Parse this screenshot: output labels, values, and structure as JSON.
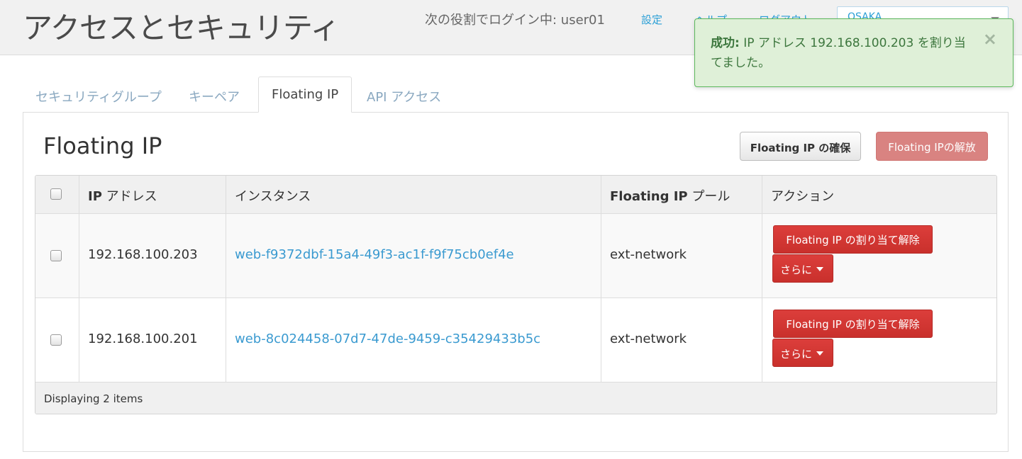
{
  "header": {
    "title": "アクセスとセキュリティ",
    "user_info": "次の役割でログイン中: user01",
    "settings_label": "設定",
    "help_label": "ヘルプ",
    "logout_label": "ログアウト",
    "region": "OSAKA"
  },
  "alert": {
    "prefix": "成功:",
    "message": "IP アドレス 192.168.100.203 を割り当てました。",
    "close": "×"
  },
  "tabs": [
    {
      "label": "セキュリティグループ"
    },
    {
      "label": "キーペア"
    },
    {
      "label": "Floating IP"
    },
    {
      "label": "API アクセス"
    }
  ],
  "panel": {
    "title": "Floating IP",
    "allocate_label": "Floating IP の確保",
    "release_label": "Floating IPの解放"
  },
  "table": {
    "columns": [
      {
        "bold": "IP",
        "rest": " アドレス"
      },
      {
        "bold": "",
        "rest": "インスタンス"
      },
      {
        "bold": "Floating IP",
        "rest": " プール"
      },
      {
        "bold": "",
        "rest": "アクション"
      }
    ],
    "rows": [
      {
        "ip": "192.168.100.203",
        "instance": "web-f9372dbf-15a4-49f3-ac1f-f9f75cb0ef4e",
        "pool": "ext-network",
        "action_label": "Floating IP の割り当て解除",
        "more_label": "さらに"
      },
      {
        "ip": "192.168.100.201",
        "instance": "web-8c024458-07d7-47de-9459-c35429433b5c",
        "pool": "ext-network",
        "action_label": "Floating IP の割り当て解除",
        "more_label": "さらに"
      }
    ],
    "footer": "Displaying 2 items"
  }
}
